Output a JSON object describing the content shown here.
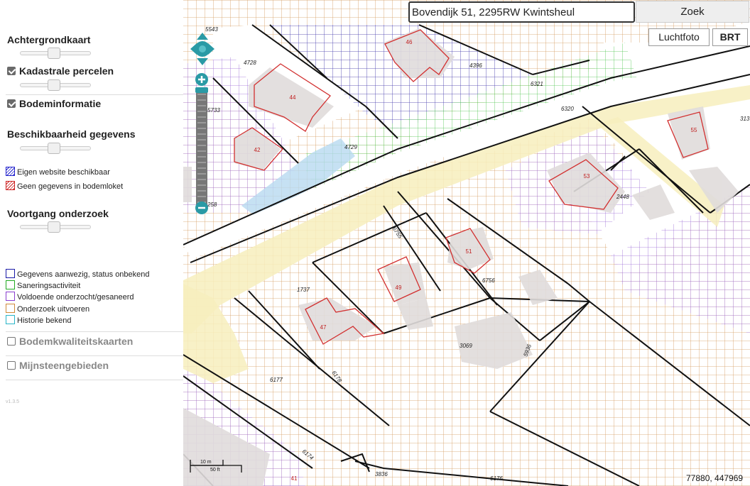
{
  "search": {
    "value": "Bovendijk 51, 2295RW Kwintsheul",
    "button": "Zoek"
  },
  "basemap_buttons": {
    "aerial": "Luchtfoto",
    "brt": "BRT"
  },
  "sidebar": {
    "basemap": {
      "title": "Achtergrondkaart",
      "opacity": 0.45
    },
    "cadastral": {
      "title": "Kadastrale percelen",
      "checked": true,
      "opacity": 0.45
    },
    "soil": {
      "title": "Bodeminformatie",
      "checked": true
    },
    "availability": {
      "title": "Beschikbaarheid gegevens",
      "opacity": 0.45,
      "legend": [
        {
          "label": "Eigen website beschikbaar",
          "color": "#2222cc"
        },
        {
          "label": "Geen gegevens in bodemloket",
          "color": "#cc2222"
        }
      ]
    },
    "progress": {
      "title": "Voortgang onderzoek",
      "opacity": 0.45,
      "legend": [
        {
          "label": "Gegevens aanwezig, status onbekend",
          "color": "#1a1aa8"
        },
        {
          "label": "Saneringsactiviteit",
          "color": "#22aa22"
        },
        {
          "label": "Voldoende onderzocht/gesaneerd",
          "color": "#8a3fd0"
        },
        {
          "label": "Onderzoek uitvoeren",
          "color": "#d08a3a"
        },
        {
          "label": "Historie bekend",
          "color": "#2ab5c8"
        }
      ]
    },
    "quality_maps": {
      "title": "Bodemkwaliteitskaarten",
      "checked": false
    },
    "mining": {
      "title": "Mijnsteengebieden",
      "checked": false
    },
    "version": "v1.3.5"
  },
  "map": {
    "coordinates": "77880, 447969",
    "scale": {
      "metric": "10 m",
      "imperial": "50 ft"
    },
    "parcel_numbers": [
      "5543",
      "4728",
      "4396",
      "6321",
      "6320",
      "5733",
      "4729",
      "2448",
      "6755",
      "6756",
      "1737",
      "3069",
      "5936",
      "6178",
      "6177",
      "6174",
      "3836",
      "6176",
      "313",
      "258"
    ],
    "house_numbers": [
      "46",
      "44",
      "42",
      "55",
      "53",
      "51",
      "49",
      "47",
      "41"
    ]
  }
}
